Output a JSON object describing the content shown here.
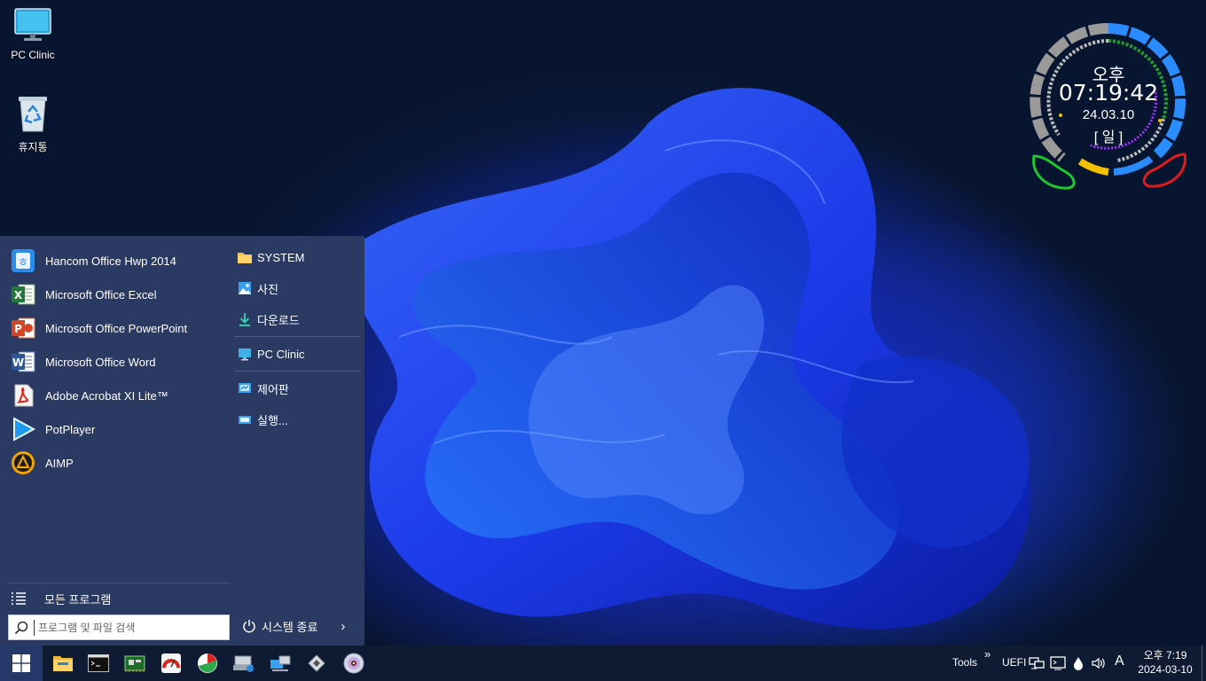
{
  "desktop": {
    "icons": [
      {
        "label": "PC Clinic",
        "icon": "monitor-icon"
      },
      {
        "label": "휴지통",
        "icon": "recycle-bin-icon"
      }
    ]
  },
  "clock_widget": {
    "ampm": "오후",
    "time": "07:19:42",
    "date": "24.03.10",
    "day": "[ 일 ]"
  },
  "start_menu": {
    "programs": [
      {
        "label": "Hancom Office Hwp 2014",
        "icon": "hwp-icon"
      },
      {
        "label": "Microsoft Office Excel",
        "icon": "excel-icon"
      },
      {
        "label": "Microsoft Office PowerPoint",
        "icon": "powerpoint-icon"
      },
      {
        "label": "Microsoft Office Word",
        "icon": "word-icon"
      },
      {
        "label": "Adobe Acrobat XI Lite™",
        "icon": "acrobat-icon"
      },
      {
        "label": "PotPlayer",
        "icon": "potplayer-icon"
      },
      {
        "label": "AIMP",
        "icon": "aimp-icon"
      }
    ],
    "all_programs": "모든 프로그램",
    "search_placeholder": "프로그램 및 파일 검색",
    "places": [
      {
        "label": "SYSTEM",
        "icon": "folder-icon"
      },
      {
        "label": "사진",
        "icon": "pictures-icon"
      },
      {
        "label": "다운로드",
        "icon": "download-icon"
      },
      {
        "label": "PC Clinic",
        "icon": "monitor-icon"
      },
      {
        "label": "제어판",
        "icon": "control-panel-icon"
      },
      {
        "label": "실행...",
        "icon": "run-icon"
      }
    ],
    "shutdown_label": "시스템 종료"
  },
  "taskbar": {
    "pinned": [
      "file-explorer-icon",
      "command-prompt-icon",
      "hardware-info-icon",
      "disk-speed-icon",
      "partition-tool-icon",
      "device-manager-icon",
      "network-icon",
      "disk-tool-icon",
      "cd-burner-icon"
    ],
    "tools_label": "Tools",
    "overflow": "»",
    "uefi_label": "UEFI",
    "ime_label": "A",
    "clock_time": "오후 7:19",
    "clock_date": "2024-03-10"
  },
  "colors": {
    "start_menu_bg": "#2b3a63",
    "taskbar_bg": "#0f1a33",
    "clock_blue": "#2a8cff",
    "clock_gray": "#9a9a9a",
    "clock_green": "#1f9e2e",
    "clock_red": "#e11b1b",
    "clock_yellow": "#f3c000",
    "clock_purple": "#a335ff"
  }
}
